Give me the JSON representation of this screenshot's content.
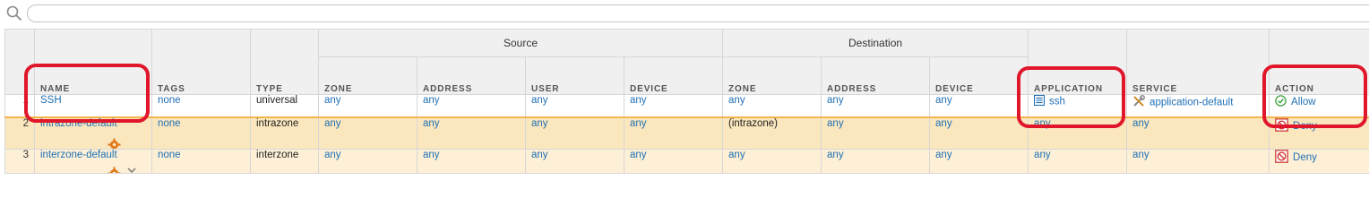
{
  "search": {
    "value": "",
    "placeholder": ""
  },
  "table": {
    "groups": {
      "source": "Source",
      "destination": "Destination"
    },
    "headers": {
      "name": "NAME",
      "tags": "TAGS",
      "type": "TYPE",
      "src_zone": "ZONE",
      "src_address": "ADDRESS",
      "src_user": "USER",
      "src_device": "DEVICE",
      "dst_zone": "ZONE",
      "dst_address": "ADDRESS",
      "dst_device": "DEVICE",
      "application": "APPLICATION",
      "service": "SERVICE",
      "action": "ACTION"
    },
    "rows": [
      {
        "num": "1",
        "name": "SSH",
        "tags": "none",
        "type": "universal",
        "src_zone": "any",
        "src_address": "any",
        "src_user": "any",
        "src_device": "any",
        "dst_zone": "any",
        "dst_address": "any",
        "dst_device": "any",
        "application": "ssh",
        "service": "application-default",
        "action": "Allow"
      },
      {
        "num": "2",
        "name": "intrazone-default",
        "tags": "none",
        "type": "intrazone",
        "src_zone": "any",
        "src_address": "any",
        "src_user": "any",
        "src_device": "any",
        "dst_zone": "(intrazone)",
        "dst_address": "any",
        "dst_device": "any",
        "application": "any",
        "service": "any",
        "action": "Deny"
      },
      {
        "num": "3",
        "name": "interzone-default",
        "tags": "none",
        "type": "interzone",
        "src_zone": "any",
        "src_address": "any",
        "src_user": "any",
        "src_device": "any",
        "dst_zone": "any",
        "dst_address": "any",
        "dst_device": "any",
        "application": "any",
        "service": "any",
        "action": "Deny"
      }
    ]
  },
  "icons": {
    "search": "search-icon",
    "application": "application-list-icon",
    "service": "service-tools-icon",
    "allow": "allow-check-icon",
    "deny": "deny-icon",
    "override": "override-gear-icon",
    "dropdown": "chevron-down-icon"
  },
  "colors": {
    "link": "#1f6fb4",
    "header_bg": "#f0f0f0",
    "row_selected_bg": "#fbe7be",
    "row_default_bg": "#fdf0d6",
    "callout": "#e0172a",
    "allow_green": "#3aa03a",
    "deny_red": "#d13a35"
  }
}
